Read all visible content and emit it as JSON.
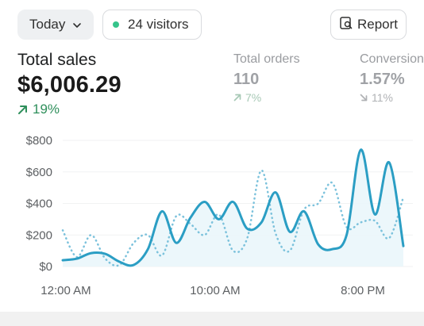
{
  "toolbar": {
    "date_range": "Today",
    "visitors": "24 visitors",
    "visitors_dot_color": "#36c48b",
    "report": "Report",
    "chevron_icon": "chevron-down-icon",
    "report_icon": "report-search-icon"
  },
  "metrics": {
    "total_sales": {
      "label": "Total sales",
      "value": "$6,006.29",
      "change": "19%",
      "trend": "up",
      "color": "#2e8f5b"
    },
    "total_orders": {
      "label": "Total orders",
      "value": "110",
      "change": "7%",
      "trend": "up"
    },
    "conversion": {
      "label": "Conversion",
      "value": "1.57%",
      "change": "11%",
      "trend": "down"
    }
  },
  "chart_data": {
    "type": "line",
    "x_tick_labels": [
      "12:00 AM",
      "10:00 AM",
      "8:00 PM"
    ],
    "y_tick_labels": [
      "$0",
      "$200",
      "$400",
      "$600",
      "$800"
    ],
    "ylim": [
      0,
      800
    ],
    "grid": true,
    "series": [
      {
        "style": "solid",
        "color": "#2b9ec4",
        "values": [
          40,
          50,
          85,
          80,
          30,
          10,
          110,
          350,
          150,
          310,
          410,
          300,
          410,
          240,
          280,
          470,
          220,
          350,
          140,
          110,
          200,
          740,
          330,
          660,
          130
        ]
      },
      {
        "style": "dotted",
        "color": "#7cc2dc",
        "values": [
          230,
          60,
          200,
          50,
          10,
          150,
          200,
          70,
          320,
          270,
          200,
          330,
          100,
          180,
          610,
          210,
          100,
          360,
          400,
          530,
          250,
          280,
          290,
          180,
          440
        ]
      }
    ]
  }
}
